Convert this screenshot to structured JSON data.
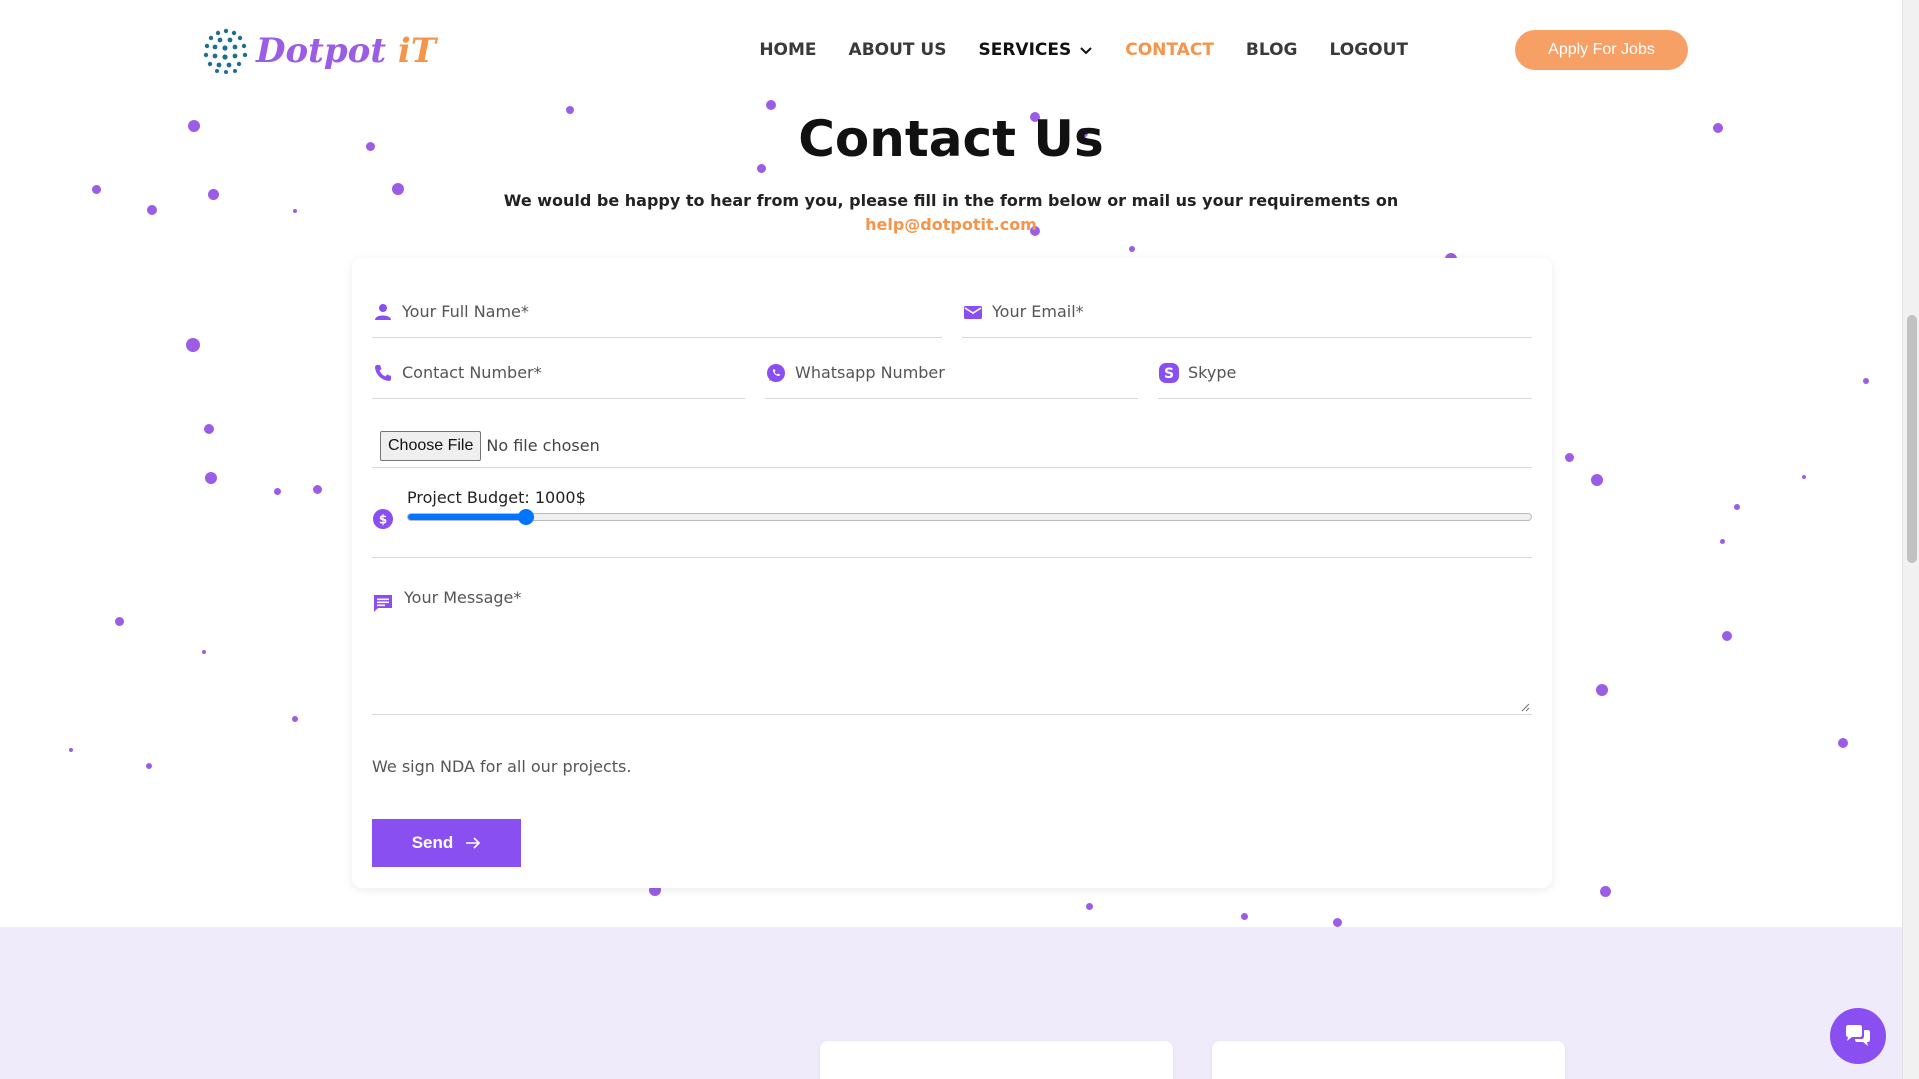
{
  "header": {
    "logo_part1": "Dotpot",
    "logo_part2": "iT",
    "nav": [
      {
        "label": "HOME"
      },
      {
        "label": "ABOUT US"
      },
      {
        "label": "SERVICES"
      },
      {
        "label": "CONTACT"
      },
      {
        "label": "BLOG"
      },
      {
        "label": "LOGOUT"
      }
    ],
    "apply_label": "Apply For Jobs"
  },
  "hero": {
    "title": "Contact Us",
    "subtitle": "We would be happy to hear from you, please fill in the form below or mail us your requirements on",
    "email": "help@dotpotit.com"
  },
  "form": {
    "full_name": {
      "placeholder": "Your Full Name*",
      "icon": "person-icon"
    },
    "email": {
      "placeholder": "Your Email*",
      "icon": "envelope-icon"
    },
    "contact": {
      "placeholder": "Contact Number*",
      "icon": "phone-icon"
    },
    "whatsapp": {
      "placeholder": "Whatsapp Number",
      "icon": "whatsapp-icon"
    },
    "skype": {
      "placeholder": "Skype",
      "icon": "skype-icon"
    },
    "file": {
      "button": "Choose File",
      "status": "No file chosen"
    },
    "budget": {
      "label": "Project Budget: 1000$",
      "value_fraction": 0.105,
      "icon": "dollar-icon"
    },
    "message": {
      "placeholder": "Your Message*",
      "icon": "message-icon"
    },
    "nda_note": "We sign NDA for all our projects.",
    "send_label": "Send"
  },
  "colors": {
    "accent_purple": "#8a4ff0",
    "accent_orange": "#f7944a",
    "slider_blue": "#0075ff",
    "lower_bg": "#efebfa"
  }
}
